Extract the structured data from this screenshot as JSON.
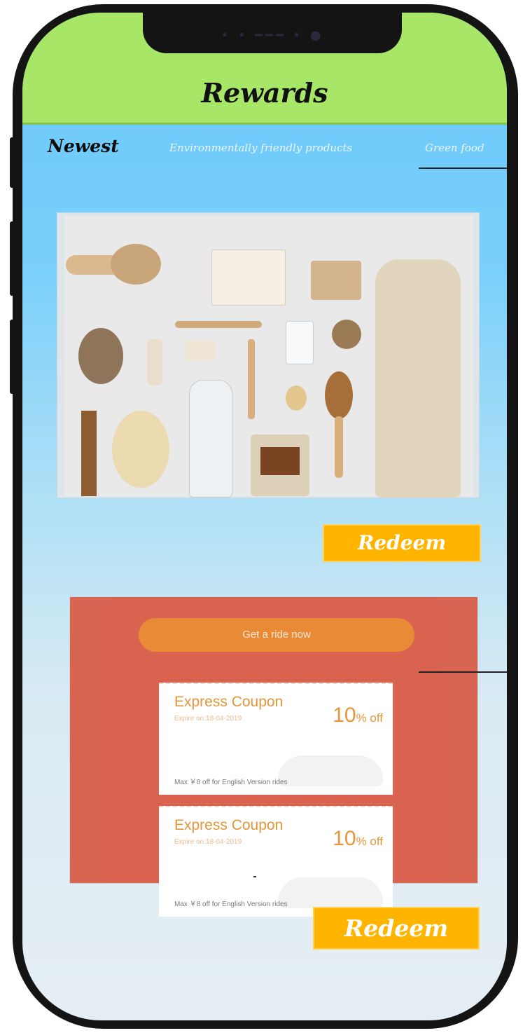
{
  "header": {
    "title": "Rewards"
  },
  "tabs": [
    {
      "label": "Newest",
      "active": true
    },
    {
      "label": "Environmentally friendly products",
      "active": false
    },
    {
      "label": "Green food",
      "active": false
    }
  ],
  "products": {
    "photo_alt": "eco-products-photo",
    "redeem_label": "Redeem"
  },
  "coupons_card": {
    "ride_button": "Get a ride now",
    "coupons": [
      {
        "name": "Express Coupon",
        "expire": "Expire on:18-04-2019",
        "percent": "10",
        "off": "% off",
        "max": "Max ￥8 off for English Version rides"
      },
      {
        "name": "Express Coupon",
        "expire": "Expire on:18-04-2019",
        "percent": "10",
        "off": "% off",
        "max": "Max ￥8 off for English Version rides"
      }
    ],
    "redeem_label": "Redeem"
  },
  "colors": {
    "header_green": "#a7e667",
    "redeem_yellow": "#ffb400",
    "coupon_card_red": "#d86551",
    "ride_orange": "#e98a36",
    "coupon_text_orange": "#e6963a"
  }
}
